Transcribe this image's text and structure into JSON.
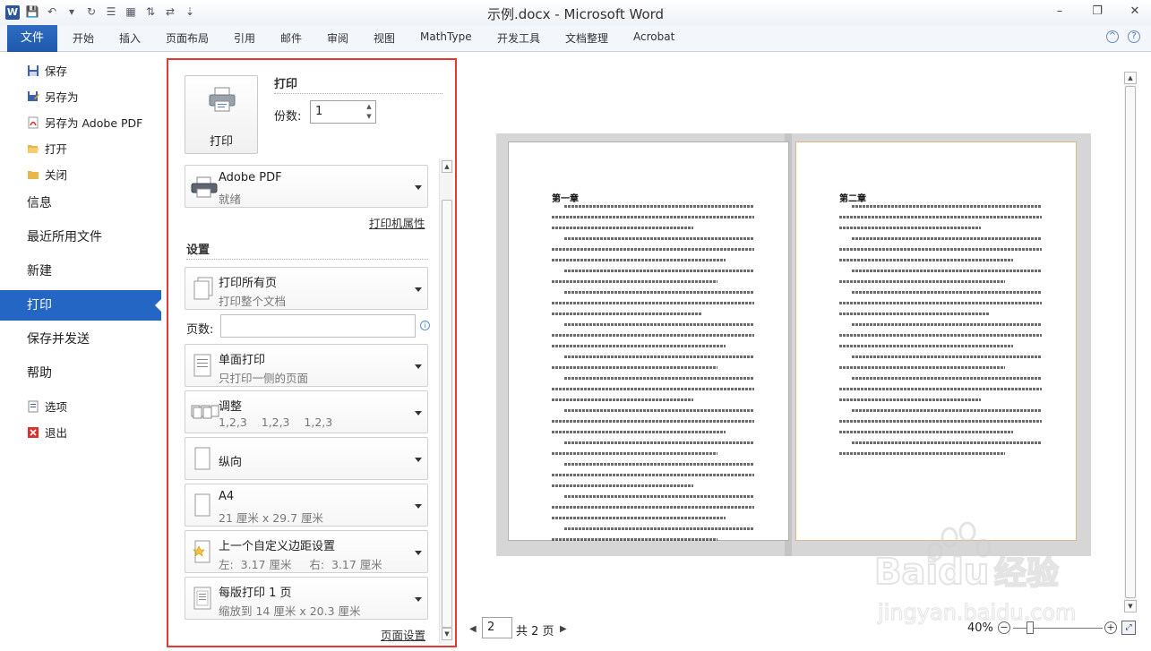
{
  "window": {
    "title": "示例.docx - Microsoft Word",
    "app_icon_letter": "W",
    "controls": [
      "–",
      "❐",
      "✕"
    ],
    "qat": [
      "💾",
      "↶",
      "▾",
      "↻",
      "☰",
      "▦",
      "⇅",
      "⇄",
      "⇣"
    ]
  },
  "ribbon": {
    "file_tab": "文件",
    "tabs": [
      "开始",
      "插入",
      "页面布局",
      "引用",
      "邮件",
      "审阅",
      "视图",
      "MathType",
      "开发工具",
      "文档整理",
      "Acrobat"
    ],
    "help_icons": [
      "^",
      "?"
    ]
  },
  "nav": {
    "small_top": [
      "保存",
      "另存为",
      "另存为 Adobe PDF",
      "打开",
      "关闭"
    ],
    "big": [
      "信息",
      "最近所用文件",
      "新建",
      "打印",
      "保存并发送",
      "帮助"
    ],
    "active": "打印",
    "small_bottom": [
      "选项",
      "退出"
    ]
  },
  "print": {
    "section_title": "打印",
    "button_label": "打印",
    "copies_label": "份数:",
    "copies_value": "1",
    "printer_name": "Adobe PDF",
    "printer_status": "就绪",
    "printer_props_link": "打印机属性",
    "settings_title": "设置",
    "pages_label": "页数:",
    "pages_value": "",
    "page_setup_link": "页面设置",
    "settings": [
      {
        "line1": "打印所有页",
        "line2": "打印整个文档"
      },
      {
        "line1": "单面打印",
        "line2": "只打印一侧的页面"
      },
      {
        "line1": "调整",
        "line2": "1,2,3    1,2,3    1,2,3"
      },
      {
        "line1": "纵向",
        "line2": ""
      },
      {
        "line1": "A4",
        "line2": "21 厘米 x 29.7 厘米"
      },
      {
        "line1": "上一个自定义边距设置",
        "line2": "左:  3.17 厘米     右:  3.17 厘米"
      },
      {
        "line1": "每版打印 1 页",
        "line2": "缩放到 14 厘米 x 20.3 厘米"
      }
    ]
  },
  "preview": {
    "page1_heading": "第一章",
    "page2_heading": "第二章",
    "current_page": "2",
    "total_pages": "共 2 页",
    "zoom": "40%"
  },
  "watermark": {
    "brand": "Baidu",
    "brand_cn": "经验",
    "url": "jingyan.baidu.com"
  }
}
